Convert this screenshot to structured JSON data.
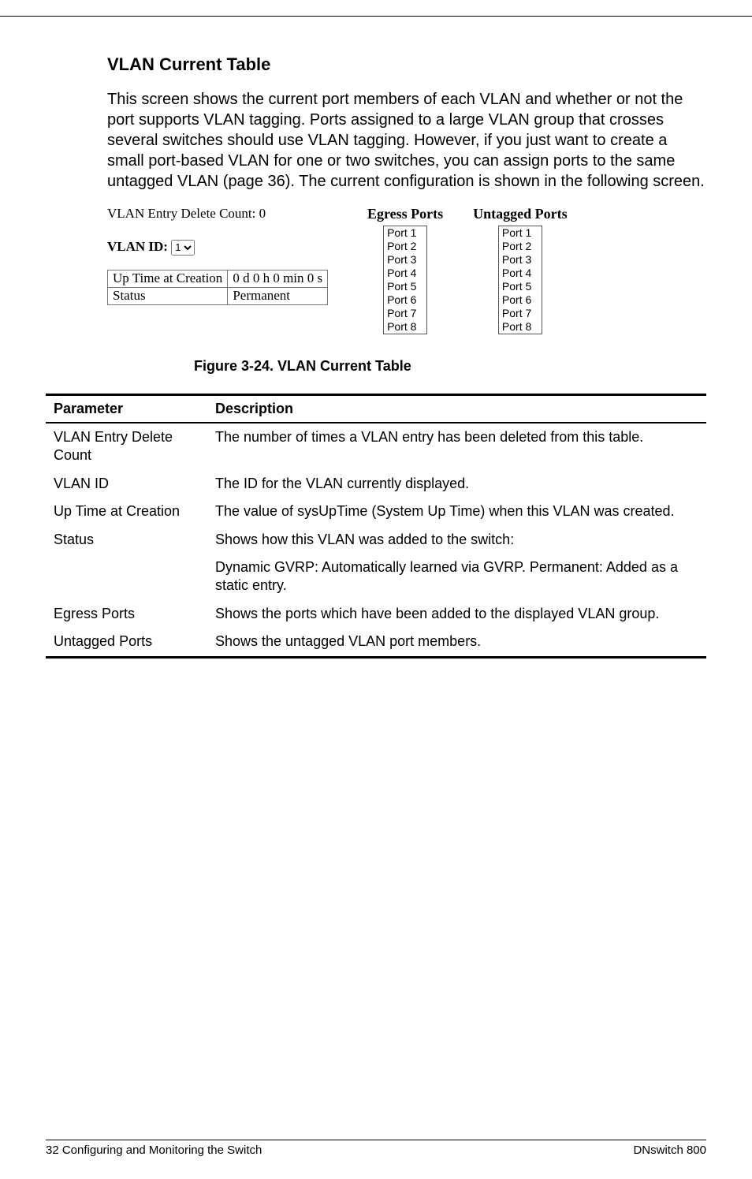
{
  "section_title": "VLAN Current Table",
  "intro_text": "This screen shows the current port members of each VLAN and whether or not the port supports VLAN tagging. Ports assigned to a large VLAN group that crosses several switches should use VLAN tagging. However, if you just want to create a small port-based VLAN for one or two switches, you can assign ports to the same untagged VLAN (page 36). The current configuration is shown in the following screen.",
  "figure": {
    "delete_count_label": "VLAN Entry Delete Count: 0",
    "vlan_id_label": "VLAN ID:",
    "vlan_id_value": "1",
    "uptime_label": "Up Time at Creation",
    "uptime_value": "0 d 0 h 0 min 0 s",
    "status_label": "Status",
    "status_value": "Permanent",
    "egress_header": "Egress Ports",
    "untagged_header": "Untagged Ports",
    "egress_ports": [
      "Port 1",
      "Port 2",
      "Port 3",
      "Port 4",
      "Port 5",
      "Port 6",
      "Port 7",
      "Port 8"
    ],
    "untagged_ports": [
      "Port 1",
      "Port 2",
      "Port 3",
      "Port 4",
      "Port 5",
      "Port 6",
      "Port 7",
      "Port 8"
    ]
  },
  "figure_caption": "Figure 3-24.  VLAN Current Table",
  "table": {
    "header_param": "Parameter",
    "header_desc": "Description",
    "rows": [
      {
        "param": "VLAN Entry Delete Count",
        "desc": "The number of times a VLAN entry has been deleted from this table."
      },
      {
        "param": "VLAN ID",
        "desc": "The ID for the VLAN currently displayed."
      },
      {
        "param": "Up Time at Creation",
        "desc": "The value of sysUpTime (System Up Time) when this VLAN was created."
      },
      {
        "param": "Status",
        "desc": "Shows how this VLAN was added to the switch:"
      },
      {
        "param": "",
        "desc": "Dynamic GVRP: Automatically learned via GVRP. Permanent: Added as a static entry."
      },
      {
        "param": "Egress Ports",
        "desc": "Shows the ports which have been added to the displayed VLAN group."
      },
      {
        "param": "Untagged Ports",
        "desc": "Shows the untagged VLAN port members."
      }
    ]
  },
  "footer": {
    "left": "32  Configuring and Monitoring the Switch",
    "right": "DNswitch 800"
  }
}
